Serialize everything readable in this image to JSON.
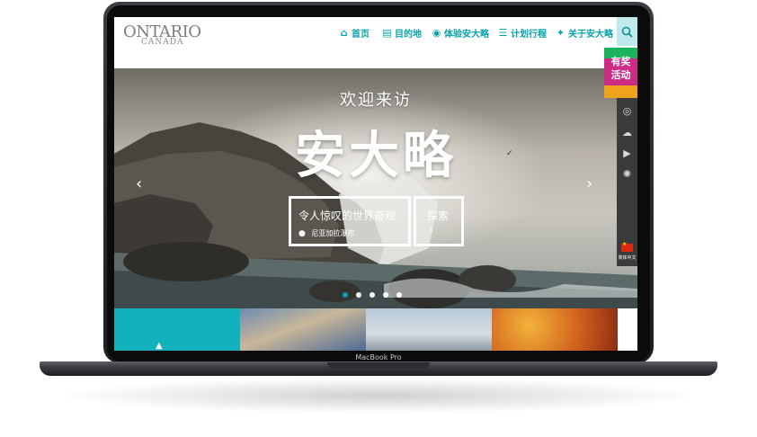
{
  "device": {
    "label": "MacBook Pro"
  },
  "logo": {
    "main": "ONTARIO",
    "sub": "CANADA"
  },
  "nav": {
    "items": [
      {
        "label": "首页",
        "icon": "home-icon"
      },
      {
        "label": "目的地",
        "icon": "map-icon"
      },
      {
        "label": "体验安大略",
        "icon": "compass-icon"
      },
      {
        "label": "计划行程",
        "icon": "list-icon"
      },
      {
        "label": "关于安大略",
        "icon": "maple-leaf-icon"
      }
    ],
    "search_icon": "search-icon"
  },
  "hero": {
    "welcome": "欢迎来访",
    "title": "安大略",
    "feature_title": "令人惊叹的世界奇观",
    "feature_location": "尼亚加拉瀑布",
    "explore_label": "探索",
    "explore_arrow": "›",
    "prev_arrow": "‹",
    "next_arrow": "›",
    "slide_count": 5,
    "active_slide": 1
  },
  "promo": {
    "line1": "有奖",
    "line2": "活动"
  },
  "social": {
    "icons": [
      "weibo-icon",
      "wechat-icon",
      "video-icon",
      "camera-shutter-icon"
    ]
  },
  "language": {
    "label": "简体中文"
  },
  "colors": {
    "accent": "#0aa3ad",
    "promo": "#cc2b86",
    "panel": "#3a3b3d"
  }
}
